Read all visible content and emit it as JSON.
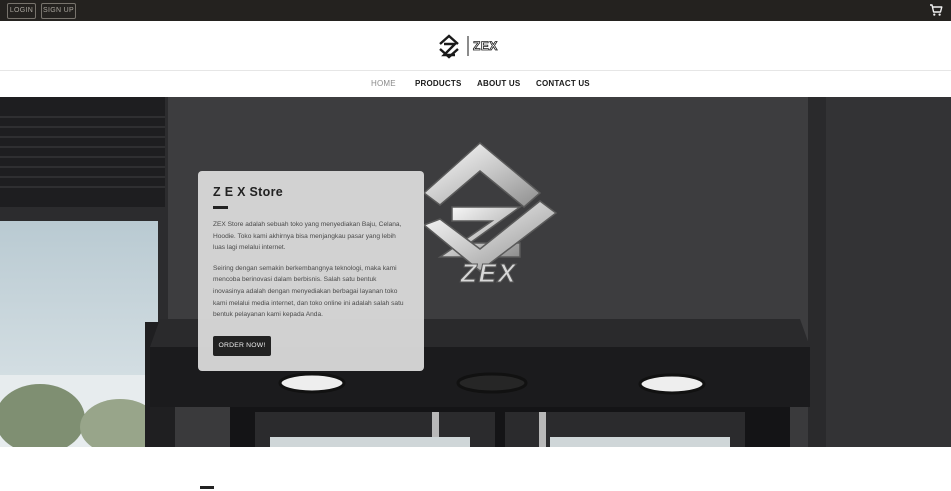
{
  "topbar": {
    "login_label": "LOGIN",
    "signup_label": "SIGN UP",
    "cart_icon": "cart-icon"
  },
  "header": {
    "logo_text": "ZEX",
    "logo_icon": "zex-logo-icon"
  },
  "nav": {
    "items": [
      {
        "label": "HOME",
        "active": true
      },
      {
        "label": "PRODUCTS",
        "active": false
      },
      {
        "label": "ABOUT US",
        "active": false
      },
      {
        "label": "CONTACT US",
        "active": false
      }
    ]
  },
  "hero": {
    "sign_text": "ZEX",
    "card": {
      "title": "Z E X Store",
      "paragraph1": "ZEX Store adalah sebuah toko yang menyediakan Baju, Celana, Hoodie. Toko kami akhirnya bisa menjangkau pasar yang lebih luas lagi melalui internet.",
      "paragraph2": "Seiring dengan semakin berkembangnya teknologi, maka kami mencoba berinovasi dalam berbisnis. Salah satu bentuk inovasinya adalah dengan menyediakan berbagai layanan toko kami melalui media internet, dan toko online ini adalah salah satu bentuk pelayanan kami kepada Anda.",
      "button_label": "ORDER NOW!"
    }
  },
  "colors": {
    "topbar_bg": "#24221f",
    "accent_dark": "#222222"
  }
}
